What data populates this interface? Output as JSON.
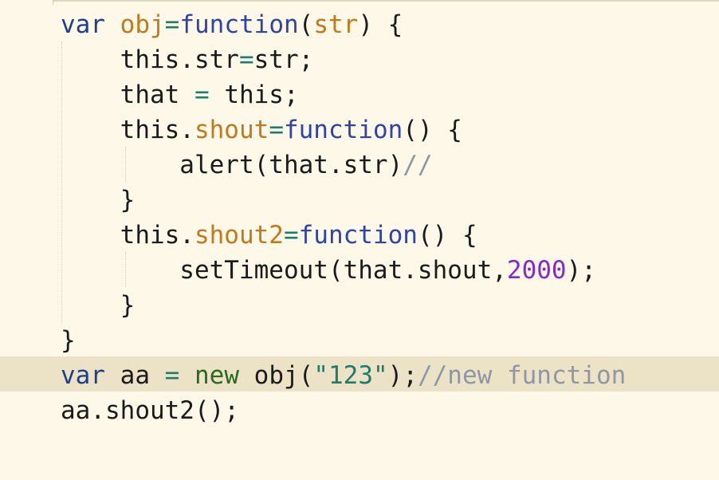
{
  "editor": {
    "lines": [
      {
        "tokens": [
          {
            "t": "var",
            "c": "kw"
          },
          {
            "t": " "
          },
          {
            "t": "obj",
            "c": "prop"
          },
          {
            "t": "=",
            "c": "str"
          },
          {
            "t": "function",
            "c": "fn"
          },
          {
            "t": "("
          },
          {
            "t": "str",
            "c": "prop"
          },
          {
            "t": ") {"
          }
        ]
      },
      {
        "tokens": [
          {
            "t": "    this.str"
          },
          {
            "t": "=",
            "c": "str"
          },
          {
            "t": "str;"
          }
        ]
      },
      {
        "tokens": [
          {
            "t": "    that "
          },
          {
            "t": "=",
            "c": "str"
          },
          {
            "t": " this;"
          }
        ]
      },
      {
        "tokens": [
          {
            "t": "    this."
          },
          {
            "t": "shout",
            "c": "prop"
          },
          {
            "t": "=",
            "c": "str"
          },
          {
            "t": "function",
            "c": "fn"
          },
          {
            "t": "() {"
          }
        ]
      },
      {
        "tokens": [
          {
            "t": "        alert(that.str)"
          },
          {
            "t": "//",
            "c": "cmt"
          }
        ]
      },
      {
        "tokens": [
          {
            "t": "    }"
          }
        ]
      },
      {
        "tokens": [
          {
            "t": "    this."
          },
          {
            "t": "shout2",
            "c": "prop"
          },
          {
            "t": "=",
            "c": "str"
          },
          {
            "t": "function",
            "c": "fn"
          },
          {
            "t": "() {"
          }
        ]
      },
      {
        "tokens": [
          {
            "t": "        setTimeout(that.shout,"
          },
          {
            "t": "2000",
            "c": "num"
          },
          {
            "t": ");"
          }
        ]
      },
      {
        "tokens": [
          {
            "t": "    }"
          }
        ]
      },
      {
        "tokens": [
          {
            "t": "}"
          }
        ]
      },
      {
        "tokens": [
          {
            "t": "var",
            "c": "kw"
          },
          {
            "t": " aa "
          },
          {
            "t": "=",
            "c": "str"
          },
          {
            "t": " "
          },
          {
            "t": "new",
            "c": "new-kw"
          },
          {
            "t": " obj("
          },
          {
            "t": "\"123\"",
            "c": "str"
          },
          {
            "t": ");"
          },
          {
            "t": "//new function",
            "c": "cmt"
          }
        ]
      },
      {
        "tokens": [
          {
            "t": "aa.shout2();"
          }
        ]
      }
    ],
    "highlighted_line": 11
  },
  "colors": {
    "background": "#fdf8e7",
    "current_line": "#ece3c6",
    "keyword": "#1f3f8a",
    "property": "#c07a1c",
    "number": "#8629c5",
    "string": "#207b6d",
    "comment": "#8f97a5"
  }
}
